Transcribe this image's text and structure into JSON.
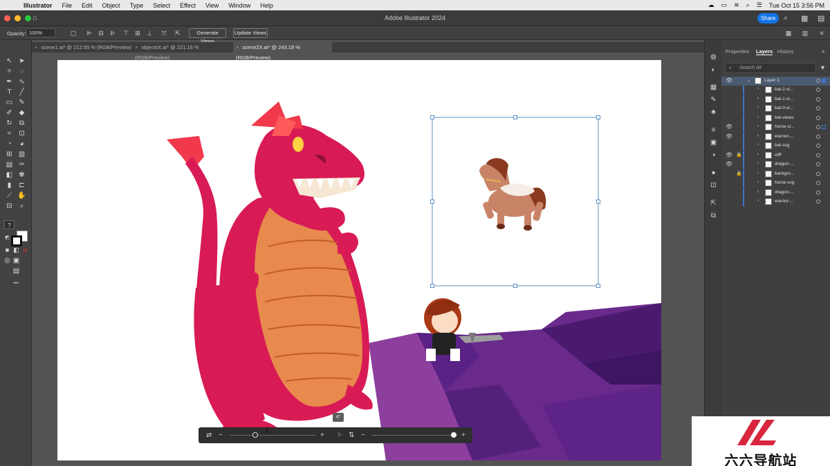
{
  "menubar": {
    "app": "Illustrator",
    "items": [
      "File",
      "Edit",
      "Object",
      "Type",
      "Select",
      "Effect",
      "View",
      "Window",
      "Help"
    ],
    "clock": "Tue Oct 15  3:56 PM"
  },
  "titlebar": {
    "title": "Adobe Illustrator 2024",
    "share_label": "Share"
  },
  "controlbar": {
    "opacity_label": "Opacity:",
    "opacity_value": "100%",
    "generate_views": "Generate Views",
    "update_views": "Update Views"
  },
  "tabs": [
    {
      "label": "scene1.ai* @ 212.55 % (RGB/Preview)"
    },
    {
      "label": "objectsX.ai* @ 221.16 % (RGB/Preview)"
    },
    {
      "label": "scene2X.ai* @ 243.19 % (RGB/Preview)",
      "active": true
    }
  ],
  "toolbar": {
    "help_glyph": "?",
    "more_glyph": "•••"
  },
  "widget": {
    "angle": "4°",
    "left_slider": 0.3,
    "right_slider": 0.95
  },
  "panel": {
    "tabs": [
      "Properties",
      "Layers",
      "History"
    ],
    "active_tab": "Layers",
    "search_placeholder": "Search All",
    "layer_name": "Layer 1",
    "sublayers": [
      {
        "name": "bat-2-vi...",
        "visible": false,
        "locked": false
      },
      {
        "name": "bat-1-vi...",
        "visible": false,
        "locked": false
      },
      {
        "name": "bat-0-vi...",
        "visible": false,
        "locked": false
      },
      {
        "name": "bat-views",
        "visible": false,
        "locked": false
      },
      {
        "name": "horse-vi...",
        "visible": true,
        "locked": false,
        "selected": true
      },
      {
        "name": "warrior-...",
        "visible": true,
        "locked": false
      },
      {
        "name": "bat-svg",
        "visible": false,
        "locked": false
      },
      {
        "name": "cliff",
        "visible": true,
        "locked": true
      },
      {
        "name": "dragon-...",
        "visible": true,
        "locked": false
      },
      {
        "name": "backgro...",
        "visible": false,
        "locked": true
      },
      {
        "name": "horse-svg",
        "visible": false,
        "locked": false
      },
      {
        "name": "dragon-...",
        "visible": false,
        "locked": false
      },
      {
        "name": "warrior-...",
        "visible": false,
        "locked": false
      }
    ]
  },
  "watermark": {
    "text": "六六导航站"
  },
  "colors": {
    "accent": "#1473e6",
    "dragon": "#d81b55",
    "dragon_belly": "#e8894d",
    "cliff": "#6a2a8c",
    "horse": "#c98468"
  }
}
